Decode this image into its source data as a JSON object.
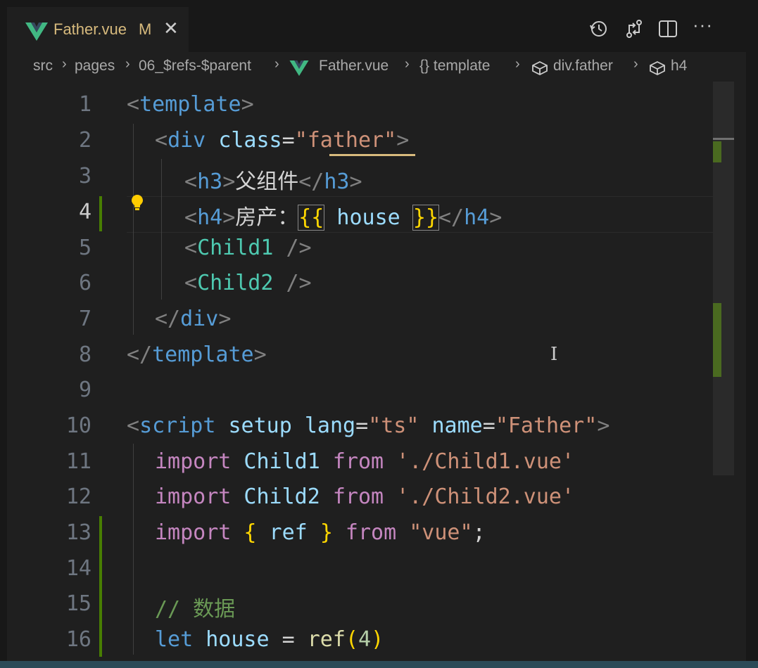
{
  "tab": {
    "title": "Father.vue",
    "modified": "M",
    "close": "✕"
  },
  "toolbar": {
    "icons": [
      "history-icon",
      "compare-changes-icon",
      "split-editor-icon",
      "more-actions-icon"
    ],
    "more": "···"
  },
  "breadcrumb": {
    "items": [
      "src",
      "pages",
      "06_$refs-$parent",
      "Father.vue",
      "{} template",
      "div.father",
      "h4"
    ],
    "separator": "›"
  },
  "editor": {
    "active_line": 4,
    "line_numbers": [
      "1",
      "2",
      "3",
      "4",
      "5",
      "6",
      "7",
      "8",
      "9",
      "10",
      "11",
      "12",
      "13",
      "14",
      "15",
      "16"
    ],
    "lines": {
      "l1": {
        "open": "<",
        "tag": "template",
        "close": ">"
      },
      "l2": {
        "open": "<",
        "tag": "div",
        "attr": "class",
        "eq": "=",
        "q1": "\"",
        "val": "father",
        "q2": "\"",
        "close": ">"
      },
      "l3": {
        "open": "<",
        "tag": "h3",
        "close": ">",
        "text": "父组件",
        "open2": "</",
        "tag2": "h3",
        "close2": ">"
      },
      "l4": {
        "open": "<",
        "tag": "h4",
        "close": ">",
        "text": "房产：",
        "b1": "{{",
        "var": " house ",
        "b2": "}}",
        "open2": "</",
        "tag2": "h4",
        "close2": ">"
      },
      "l5": {
        "open": "<",
        "comp": "Child1",
        "close": " />"
      },
      "l6": {
        "open": "<",
        "comp": "Child2",
        "close": " />"
      },
      "l7": {
        "open": "</",
        "tag": "div",
        "close": ">"
      },
      "l8": {
        "open": "</",
        "tag": "template",
        "close": ">"
      },
      "l10": {
        "open": "<",
        "tag": "script",
        "a1": " setup lang",
        "eq": "=",
        "v1": "\"ts\"",
        "a2": " name",
        "eq2": "=",
        "v2": "\"Father\"",
        "close": ">"
      },
      "l11": {
        "kw": "import",
        "id": " Child1 ",
        "from": "from",
        "str": " './Child1.vue'"
      },
      "l12": {
        "kw": "import",
        "id": " Child2 ",
        "from": "from",
        "str": " './Child2.vue'"
      },
      "l13": {
        "kw": "import",
        "b1": " {",
        "id": " ref ",
        "b2": "}",
        "from": " from",
        "str": " \"vue\"",
        "semi": ";"
      },
      "l15": {
        "comment": "// 数据"
      },
      "l16": {
        "kw": "let",
        "id": " house ",
        "eq": "= ",
        "fn": "ref",
        "p1": "(",
        "num": "4",
        "p2": ")"
      }
    }
  },
  "colors": {
    "background": "#1f1f1f",
    "tag": "#569cd6",
    "attribute": "#9cdcfe",
    "string": "#ce9178",
    "component": "#4ec9b0",
    "keyword": "#c586c0",
    "comment": "#6a9955",
    "bracket": "#ffd700",
    "modified_gutter": "#487e02",
    "vue_green": "#41b883"
  }
}
